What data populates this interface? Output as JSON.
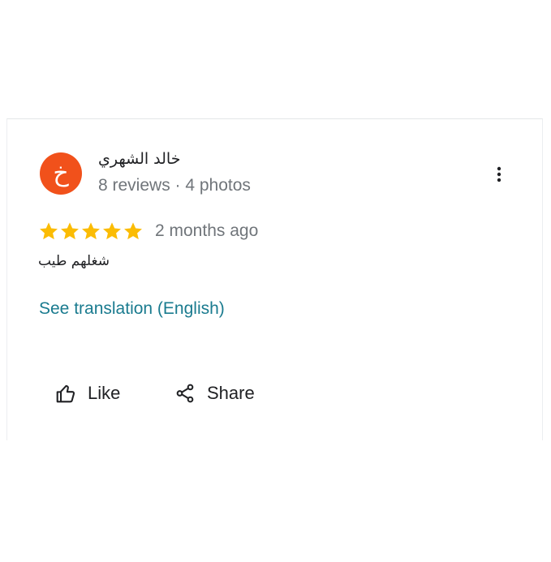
{
  "colors": {
    "avatar_bg": "#f1511b",
    "star": "#fbbc04",
    "link": "#1a7b8f",
    "meta_text": "#70757a"
  },
  "reviewer": {
    "avatar_letter": "خ",
    "name": "خالد الشهري",
    "meta": "8 reviews · 4 photos"
  },
  "menu": {
    "icon": "more-vert-icon"
  },
  "review": {
    "rating": 5,
    "max_rating": 5,
    "time": "2 months ago",
    "text": "شغلهم طيب",
    "translate_label": "See translation (English)"
  },
  "actions": {
    "like": {
      "icon": "thumb-up-icon",
      "label": "Like"
    },
    "share": {
      "icon": "share-icon",
      "label": "Share"
    }
  }
}
